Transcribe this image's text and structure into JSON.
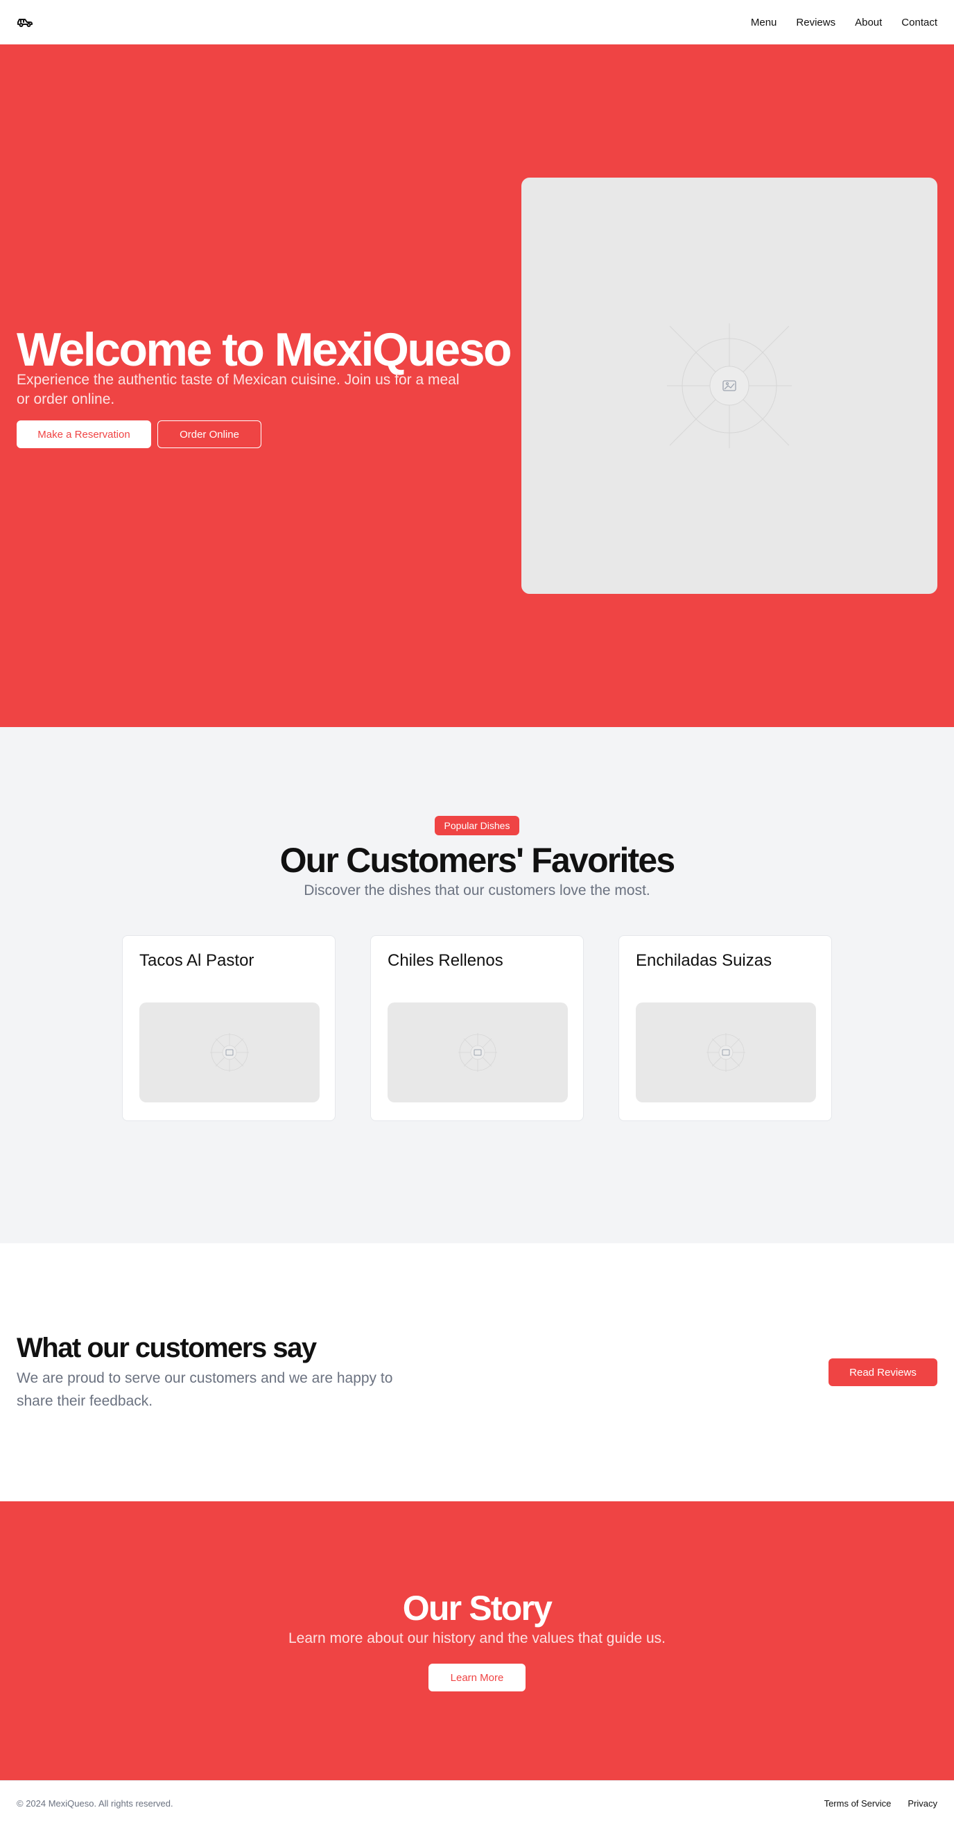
{
  "header": {
    "logo_icon": "car-icon",
    "nav": [
      {
        "label": "Menu"
      },
      {
        "label": "Reviews"
      },
      {
        "label": "About"
      },
      {
        "label": "Contact"
      }
    ]
  },
  "hero": {
    "title": "Welcome to MexiQueso",
    "subtitle": "Experience the authentic taste of Mexican cuisine. Join us for a meal or order online.",
    "primary_button": "Make a Reservation",
    "secondary_button": "Order Online",
    "image_icon": "image-placeholder-icon"
  },
  "favorites": {
    "badge": "Popular Dishes",
    "title": "Our Customers' Favorites",
    "subtitle": "Discover the dishes that our customers love the most.",
    "dishes": [
      {
        "name": "Tacos Al Pastor"
      },
      {
        "name": "Chiles Rellenos"
      },
      {
        "name": "Enchiladas Suizas"
      }
    ]
  },
  "testimonials": {
    "title": "What our customers say",
    "subtitle": "We are proud to serve our customers and we are happy to share their feedback.",
    "button": "Read Reviews"
  },
  "story": {
    "title": "Our Story",
    "subtitle": "Learn more about our history and the values that guide us.",
    "button": "Learn More"
  },
  "footer": {
    "copyright": "© 2024 MexiQueso. All rights reserved.",
    "links": [
      {
        "label": "Terms of Service"
      },
      {
        "label": "Privacy"
      }
    ]
  },
  "colors": {
    "brand": "#ef4444",
    "muted_text": "#6b7280",
    "section_bg": "#f3f4f6",
    "placeholder_bg": "#e8e8e8"
  }
}
